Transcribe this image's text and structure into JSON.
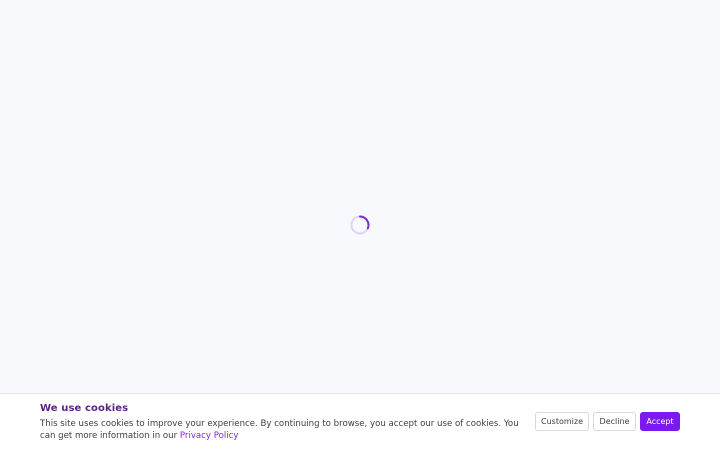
{
  "loading": {
    "spinner_icon": "loading-spinner-icon",
    "track_color": "#e3d2f2",
    "arc_color": "#7a2fc8"
  },
  "cookie_banner": {
    "title": "We use cookies",
    "message": "This site uses cookies to improve your experience. By continuing to browse, you accept our use of cookies. You can get more information in our ",
    "link_text": "Privacy Policy",
    "buttons": {
      "customize": "Customize",
      "decline": "Decline",
      "accept": "Accept"
    },
    "colors": {
      "title": "#5b1f8c",
      "link": "#7b2bd6",
      "accept_background": "#7c18f0"
    }
  }
}
